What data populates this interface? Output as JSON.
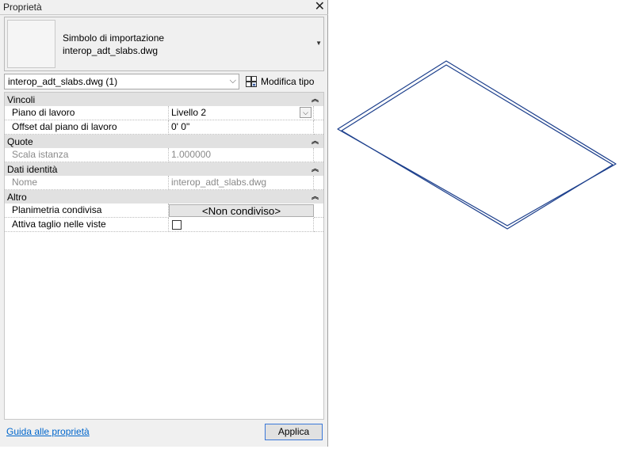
{
  "panel": {
    "title": "Proprietà",
    "type_selector": {
      "line1": "Simbolo di importazione",
      "line2": "interop_adt_slabs.dwg"
    },
    "filter_value": "interop_adt_slabs.dwg (1)",
    "edit_type_label": "Modifica tipo",
    "groups": {
      "vincoli": {
        "label": "Vincoli",
        "rows": [
          {
            "key": "Piano di lavoro",
            "value": "Livello 2"
          },
          {
            "key": "Offset dal piano di lavoro",
            "value": "0'  0\""
          }
        ]
      },
      "quote": {
        "label": "Quote",
        "rows": [
          {
            "key": "Scala istanza",
            "value": "1.000000"
          }
        ]
      },
      "dati": {
        "label": "Dati identità",
        "rows": [
          {
            "key": "Nome",
            "value": "interop_adt_slabs.dwg"
          }
        ]
      },
      "altro": {
        "label": "Altro",
        "rows": [
          {
            "key": "Planimetria condivisa",
            "value": "<Non condiviso>"
          },
          {
            "key": "Attiva taglio nelle viste",
            "checked": false
          }
        ]
      }
    },
    "help_link": "Guida alle proprietà",
    "apply_label": "Applica"
  },
  "colors": {
    "slab_outline": "#1c3f8c",
    "link": "#0066cc",
    "group_header": "#e1e1e1"
  }
}
